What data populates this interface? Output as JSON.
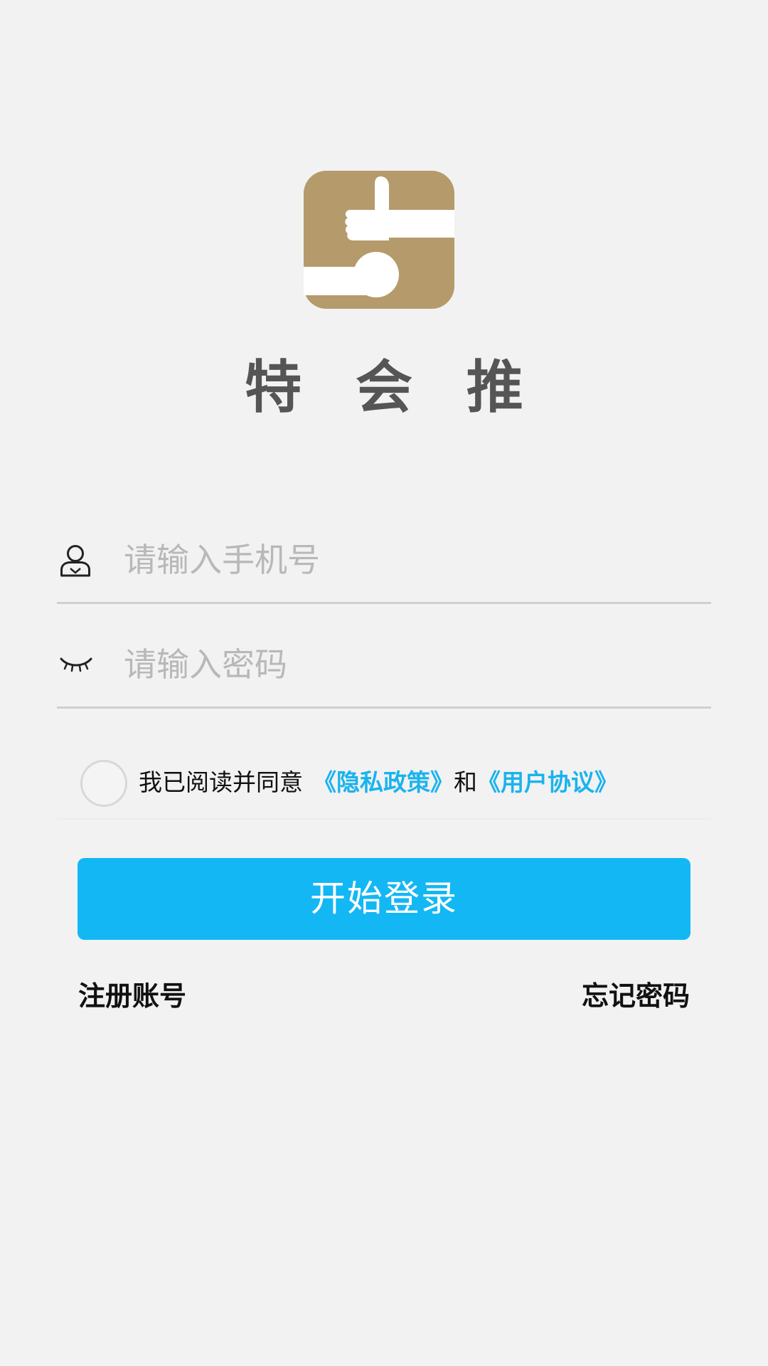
{
  "app": {
    "name": "特 会 推",
    "logo_icon": "thumbs-up-handshake-logo",
    "logo_color": "#b59a6b"
  },
  "login_form": {
    "phone": {
      "icon": "user-icon",
      "placeholder": "请输入手机号",
      "value": ""
    },
    "password": {
      "icon": "eye-closed-icon",
      "placeholder": "请输入密码",
      "value": ""
    }
  },
  "agreement": {
    "checked": false,
    "prefix": "我已阅读并同意",
    "privacy_link": "《隐私政策》",
    "conjunction": "和",
    "terms_link": "《用户协议》",
    "link_color": "#1ab3ee"
  },
  "actions": {
    "login_label": "开始登录",
    "login_color": "#13b7f4",
    "register_label": "注册账号",
    "forgot_label": "忘记密码"
  }
}
